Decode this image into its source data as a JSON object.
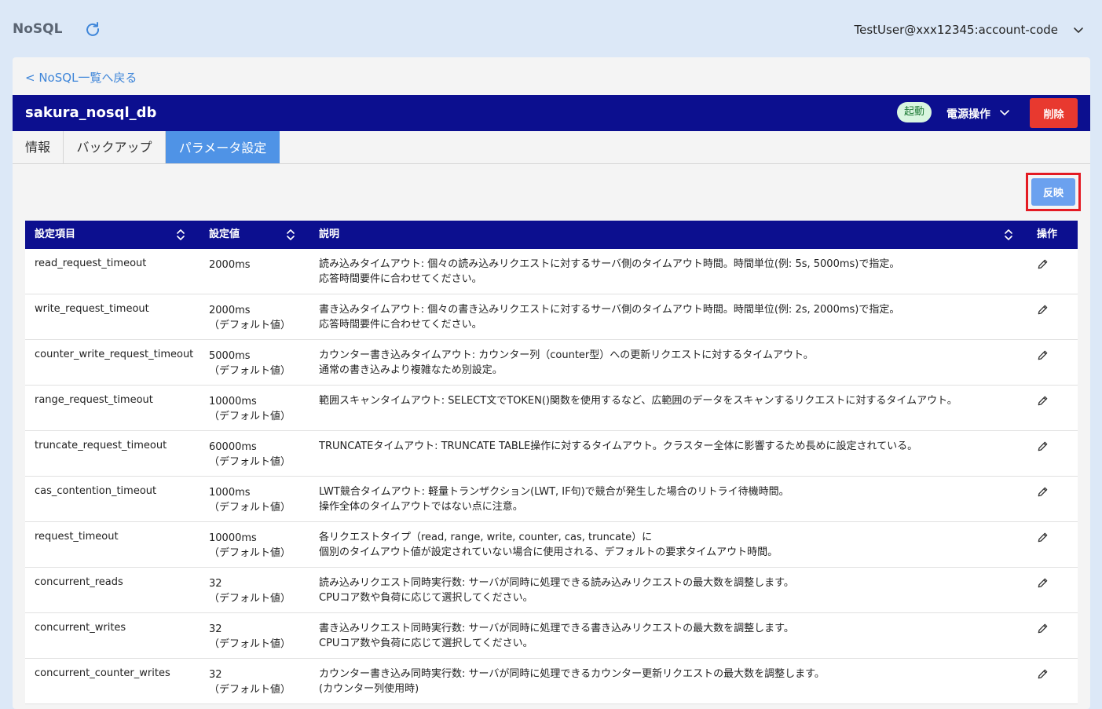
{
  "header": {
    "app_title": "NoSQL",
    "user": "TestUser@xxx12345:account-code"
  },
  "nav": {
    "back_link": "< NoSQL一覧へ戻る"
  },
  "resource": {
    "name": "sakura_nosql_db",
    "status": "起動",
    "power_label": "電源操作",
    "delete_label": "削除"
  },
  "tabs": [
    {
      "label": "情報"
    },
    {
      "label": "バックアップ"
    },
    {
      "label": "パラメータ設定"
    }
  ],
  "actions": {
    "apply_label": "反映"
  },
  "table": {
    "headers": {
      "name": "設定項目",
      "value": "設定値",
      "desc": "説明",
      "ops": "操作"
    },
    "rows": [
      {
        "name": "read_request_timeout",
        "value": "2000ms",
        "default": "",
        "desc1": "読み込みタイムアウト: 個々の読み込みリクエストに対するサーバ側のタイムアウト時間。時間単位(例: 5s, 5000ms)で指定。",
        "desc2": "応答時間要件に合わせてください。"
      },
      {
        "name": "write_request_timeout",
        "value": "2000ms",
        "default": "（デフォルト値）",
        "desc1": "書き込みタイムアウト: 個々の書き込みリクエストに対するサーバ側のタイムアウト時間。時間単位(例: 2s, 2000ms)で指定。",
        "desc2": "応答時間要件に合わせてください。"
      },
      {
        "name": "counter_write_request_timeout",
        "value": "5000ms",
        "default": "（デフォルト値）",
        "desc1": "カウンター書き込みタイムアウト: カウンター列（counter型）への更新リクエストに対するタイムアウト。",
        "desc2": "通常の書き込みより複雑なため別設定。"
      },
      {
        "name": "range_request_timeout",
        "value": "10000ms",
        "default": "（デフォルト値）",
        "desc1": "範囲スキャンタイムアウト: SELECT文でTOKEN()関数を使用するなど、広範囲のデータをスキャンするリクエストに対するタイムアウト。",
        "desc2": ""
      },
      {
        "name": "truncate_request_timeout",
        "value": "60000ms",
        "default": "（デフォルト値）",
        "desc1": "TRUNCATEタイムアウト: TRUNCATE TABLE操作に対するタイムアウト。クラスター全体に影響するため長めに設定されている。",
        "desc2": ""
      },
      {
        "name": "cas_contention_timeout",
        "value": "1000ms",
        "default": "（デフォルト値）",
        "desc1": "LWT競合タイムアウト: 軽量トランザクション(LWT, IF句)で競合が発生した場合のリトライ待機時間。",
        "desc2": "操作全体のタイムアウトではない点に注意。"
      },
      {
        "name": "request_timeout",
        "value": "10000ms",
        "default": "（デフォルト値）",
        "desc1": "各リクエストタイプ（read, range, write, counter, cas, truncate）に",
        "desc2": "個別のタイムアウト値が設定されていない場合に使用される、デフォルトの要求タイムアウト時間。"
      },
      {
        "name": "concurrent_reads",
        "value": "32",
        "default": "（デフォルト値）",
        "desc1": "読み込みリクエスト同時実行数: サーバが同時に処理できる読み込みリクエストの最大数を調整します。",
        "desc2": "CPUコア数や負荷に応じて選択してください。"
      },
      {
        "name": "concurrent_writes",
        "value": "32",
        "default": "（デフォルト値）",
        "desc1": "書き込みリクエスト同時実行数: サーバが同時に処理できる書き込みリクエストの最大数を調整します。",
        "desc2": "CPUコア数や負荷に応じて選択してください。"
      },
      {
        "name": "concurrent_counter_writes",
        "value": "32",
        "default": "（デフォルト値）",
        "desc1": "カウンター書き込み同時実行数: サーバが同時に処理できるカウンター更新リクエストの最大数を調整します。",
        "desc2": "(カウンター列使用時)"
      }
    ]
  },
  "colors": {
    "header_bar": "#0c0f8f",
    "page_bg": "#dce8f7",
    "tab_active": "#4f93e6",
    "delete": "#e8392f",
    "apply": "#6ba1ef",
    "highlight": "#e41b23",
    "status_badge": "#d9f6e0"
  },
  "icons": {
    "refresh": "refresh-icon",
    "user_menu": "chevron-down-icon",
    "sort": "sort-icon",
    "edit": "pencil-icon"
  }
}
